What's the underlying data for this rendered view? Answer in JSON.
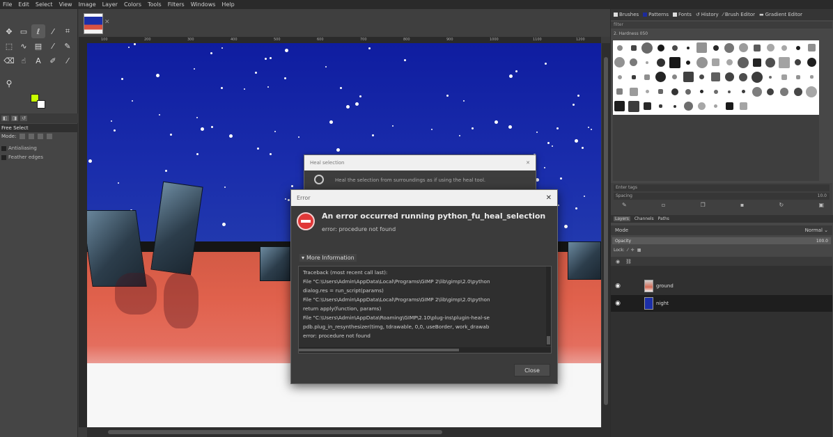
{
  "menu": [
    "File",
    "Edit",
    "Select",
    "View",
    "Image",
    "Layer",
    "Colors",
    "Tools",
    "Filters",
    "Windows",
    "Help"
  ],
  "colors": {
    "foreground": "#c8ff00",
    "background": "#ffffff",
    "error_icon": "#e03838",
    "sky": "#1a2dac",
    "ground": "#e0614c"
  },
  "tool_options": {
    "title": "Free Select",
    "mode_label": "Mode:",
    "antialiasing": "Antialiasing",
    "feather": "Feather edges"
  },
  "ruler_marks": [
    "100",
    "200",
    "300",
    "400",
    "500",
    "600",
    "700",
    "800",
    "900",
    "1000",
    "1100",
    "1200"
  ],
  "dock": {
    "tabs": [
      "Brushes",
      "Patterns",
      "Fonts",
      "History",
      "Brush Editor",
      "Gradient Editor"
    ],
    "filter_placeholder": "filter",
    "brush_caption": "2. Hardness 050",
    "tag_placeholder": "Enter tags",
    "spacing_label": "Spacing",
    "spacing_value": "10.0"
  },
  "layers_panel": {
    "tabs": [
      "Layers",
      "Channels",
      "Paths"
    ],
    "mode_label": "Mode",
    "mode_value": "Normal",
    "opacity_label": "Opacity",
    "opacity_value": "100.0",
    "lock_label": "Lock:",
    "layers": [
      {
        "name": "ground",
        "visible": true
      },
      {
        "name": "night",
        "visible": true
      }
    ]
  },
  "background_dialog": {
    "title": "Heal selection",
    "body": "Heal the selection from surroundings as if using the heal tool."
  },
  "error_dialog": {
    "title": "Error",
    "heading": "An error occurred running python_fu_heal_selection",
    "subtitle": "error: procedure not found",
    "more_info": "More Information",
    "traceback": [
      "Traceback (most recent call last):",
      "  File \"C:\\Users\\Admin\\AppData\\Local\\Programs\\GIMP 2\\lib\\gimp\\2.0\\python",
      "    dialog.res = run_script(params)",
      "  File \"C:\\Users\\Admin\\AppData\\Local\\Programs\\GIMP 2\\lib\\gimp\\2.0\\python",
      "    return apply(function, params)",
      "  File \"C:\\Users\\Admin\\AppData\\Roaming\\GIMP\\2.10\\plug-ins\\plugin-heal-se",
      "    pdb.plug_in_resynthesizer(timg, tdrawable, 0,0, useBorder, work_drawab",
      "error: procedure not found"
    ],
    "close_label": "Close"
  }
}
